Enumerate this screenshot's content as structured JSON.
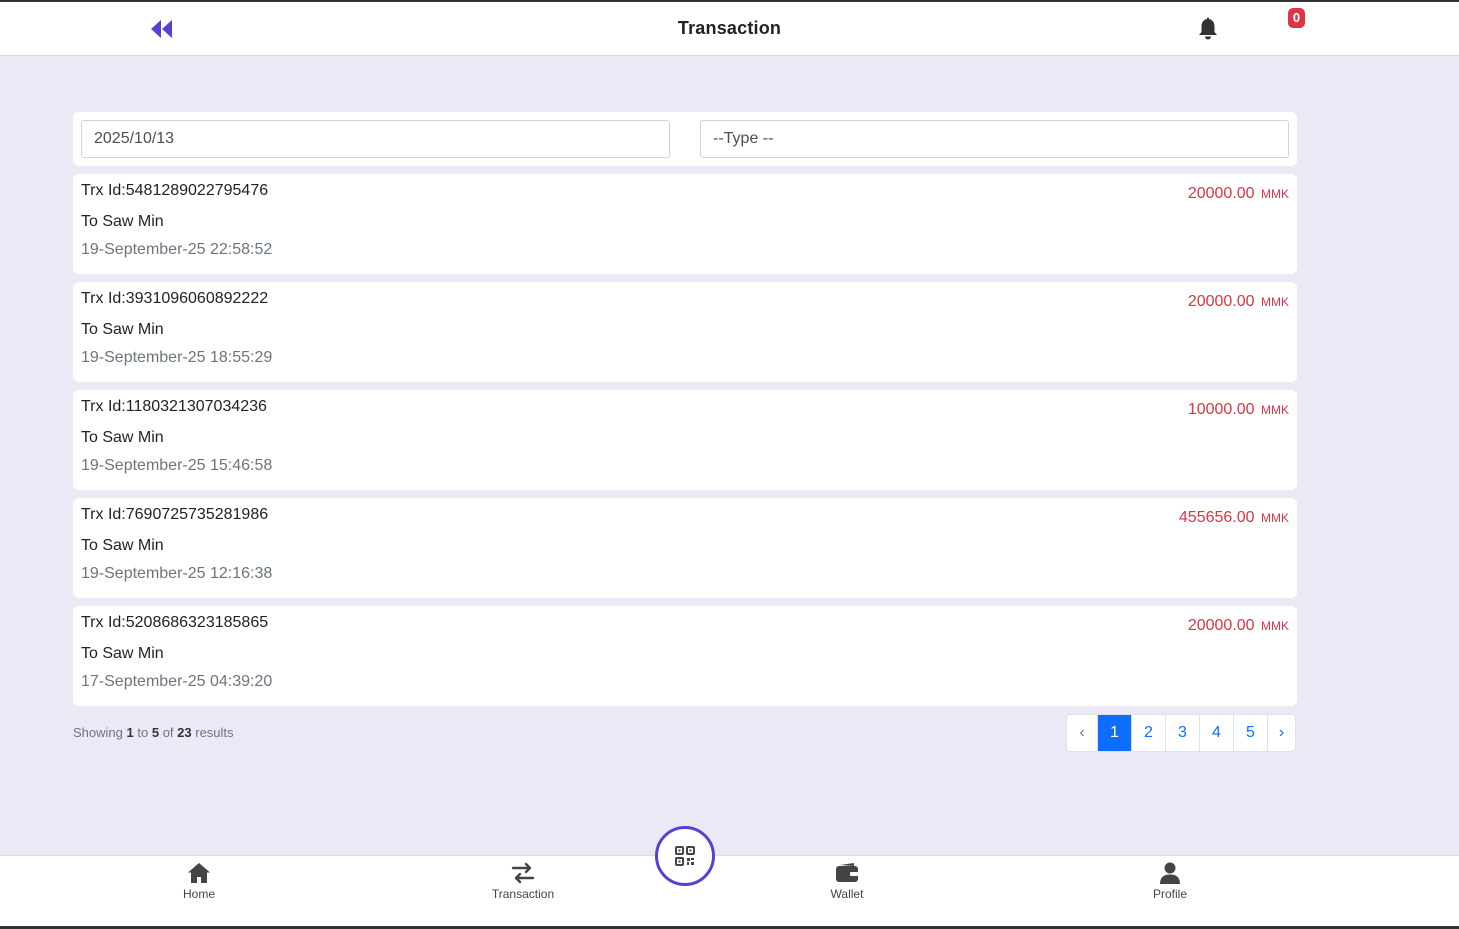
{
  "header": {
    "title": "Transaction",
    "notification_count": "0",
    "back_icon": "double-chevron-left-icon",
    "bell_icon": "bell-icon"
  },
  "filters": {
    "date_value": "2025/10/13",
    "type_value": "--Type --"
  },
  "transactions": [
    {
      "id_label": "Trx Id:5481289022795476",
      "to": "To Saw Min",
      "datetime": "19-September-25 22:58:52",
      "amount": "20000.00",
      "currency": "MMK"
    },
    {
      "id_label": "Trx Id:3931096060892222",
      "to": "To Saw Min",
      "datetime": "19-September-25 18:55:29",
      "amount": "20000.00",
      "currency": "MMK"
    },
    {
      "id_label": "Trx Id:1180321307034236",
      "to": "To Saw Min",
      "datetime": "19-September-25 15:46:58",
      "amount": "10000.00",
      "currency": "MMK"
    },
    {
      "id_label": "Trx Id:7690725735281986",
      "to": "To Saw Min",
      "datetime": "19-September-25 12:16:38",
      "amount": "455656.00",
      "currency": "MMK"
    },
    {
      "id_label": "Trx Id:5208686323185865",
      "to": "To Saw Min",
      "datetime": "17-September-25 04:39:20",
      "amount": "20000.00",
      "currency": "MMK"
    }
  ],
  "results": {
    "prefix": "Showing",
    "from": "1",
    "to_word": "to",
    "to": "5",
    "of_word": "of",
    "total": "23",
    "suffix": "results"
  },
  "pagination": {
    "prev": "‹",
    "pages": [
      "1",
      "2",
      "3",
      "4",
      "5"
    ],
    "active": "1",
    "next": "›"
  },
  "bottom_nav": {
    "items": [
      {
        "label": "Home",
        "icon": "home-icon"
      },
      {
        "label": "Transaction",
        "icon": "transfer-arrows-icon"
      },
      {
        "label": "Wallet",
        "icon": "wallet-icon"
      },
      {
        "label": "Profile",
        "icon": "user-icon"
      }
    ],
    "scan_icon": "qr-code-icon"
  },
  "colors": {
    "accent": "#5b3fd4",
    "amount": "#dc3545",
    "page_active": "#0d6efd",
    "background": "#ebe9f5"
  }
}
